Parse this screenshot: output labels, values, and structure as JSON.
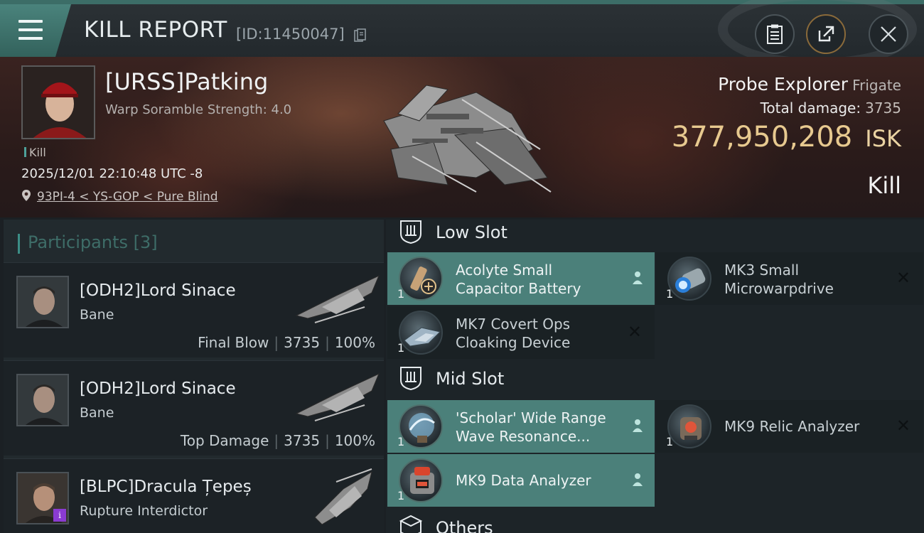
{
  "header": {
    "title": "KILL REPORT",
    "id_text": "[ID:11450047]"
  },
  "victim": {
    "name": "[URSS]Patking",
    "warp_scramble": "Warp Soramble Strength: 4.0",
    "kill_tag": "Kill",
    "datetime": "2025/12/01 22:10:48 UTC -8",
    "location": "93PI-4 < YS-GOP < Pure Blind",
    "ship_name": "Probe Explorer",
    "ship_class": "Frigate",
    "total_damage_label": "Total damage:",
    "total_damage_value": "3735",
    "isk_value": "377,950,208",
    "isk_unit": "ISK",
    "result": "Kill"
  },
  "participants": {
    "label": "Participants",
    "count": "[3]",
    "items": [
      {
        "name": "[ODH2]Lord Sinace",
        "ship": "Bane",
        "role": "Final Blow",
        "damage": "3735",
        "percent": "100%"
      },
      {
        "name": "[ODH2]Lord Sinace",
        "ship": "Bane",
        "role": "Top Damage",
        "damage": "3735",
        "percent": "100%"
      },
      {
        "name": "[BLPC]Dracula Țepeș",
        "ship": "Rupture Interdictor"
      }
    ]
  },
  "slots": {
    "low_label": "Low Slot",
    "mid_label": "Mid Slot",
    "others_label": "Others",
    "low": [
      {
        "qty": "1",
        "name1": "Acolyte Small",
        "name2": "Capacitor Battery",
        "fitted": true
      },
      {
        "qty": "1",
        "name1": "MK3 Small",
        "name2": "Microwarpdrive",
        "fitted": false
      },
      {
        "qty": "1",
        "name1": "MK7 Covert Ops",
        "name2": "Cloaking Device",
        "fitted": false
      }
    ],
    "mid": [
      {
        "qty": "1",
        "name1": "'Scholar' Wide Range",
        "name2": "Wave Resonance...",
        "fitted": true
      },
      {
        "qty": "1",
        "name1": "MK9 Relic Analyzer",
        "fitted": false
      },
      {
        "qty": "1",
        "name1": "MK9 Data Analyzer",
        "fitted": true
      }
    ]
  },
  "colors": {
    "accent": "#4b807a",
    "isk_gold": "#e7c98f"
  },
  "icons": [
    "menu-icon",
    "copy-icon",
    "clipboard-icon",
    "share-icon",
    "close-icon",
    "location-pin-icon",
    "person-icon",
    "remove-x-icon",
    "slot-shield-icon",
    "box-icon"
  ]
}
